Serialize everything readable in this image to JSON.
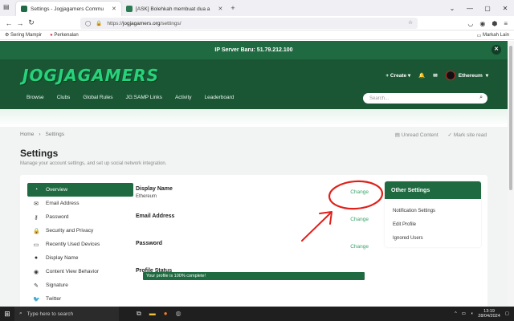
{
  "browser": {
    "tabs": [
      {
        "label": "Settings - Jogjagamers Commu",
        "active": true
      },
      {
        "label": "[ASK] Bolehkah membuat dua a",
        "active": false
      }
    ],
    "url_prefix": "https://",
    "url_host": "jogjagamers.org",
    "url_path": "/settings/",
    "bookmarks": [
      "Sering Mampir",
      "Perkenalan"
    ],
    "bookmarks_right": "Markah Lain"
  },
  "site": {
    "announcement": "IP Server Baru: 51.79.212.100",
    "logo": "JOGJAGAMERS",
    "create_label": "Create",
    "username": "Ethereum",
    "menu": [
      "Browse",
      "Clubs",
      "Global Rules",
      "JG:SAMP Links",
      "Activity",
      "Leaderboard"
    ],
    "search_placeholder": "Search..."
  },
  "page": {
    "breadcrumb": [
      "Home",
      "Settings"
    ],
    "unread": "Unread Content",
    "mark_read": "Mark site read",
    "title": "Settings",
    "subtitle": "Manage your account settings, and set up social network integration."
  },
  "sidebar": {
    "items": [
      {
        "label": "Overview",
        "icon": "tachometer-icon",
        "active": true
      },
      {
        "label": "Email Address",
        "icon": "envelope-icon"
      },
      {
        "label": "Password",
        "icon": "key-icon"
      },
      {
        "label": "Security and Privacy",
        "icon": "lock-icon"
      },
      {
        "label": "Recently Used Devices",
        "icon": "laptop-icon"
      },
      {
        "label": "Display Name",
        "icon": "user-icon"
      },
      {
        "label": "Content View Behavior",
        "icon": "eye-icon"
      },
      {
        "label": "Signature",
        "icon": "pencil-icon"
      },
      {
        "label": "Twitter",
        "icon": "twitter-icon"
      }
    ]
  },
  "overview": {
    "display_name_label": "Display Name",
    "display_name_value": "Ethereum",
    "email_label": "Email Address",
    "password_label": "Password",
    "change_label": "Change",
    "profile_status_label": "Profile Status",
    "profile_complete_text": "Your profile is 100% complete!",
    "profile_complete_fraction": 1.0
  },
  "other_settings": {
    "title": "Other Settings",
    "links": [
      "Notification Settings",
      "Edit Profile",
      "Ignored Users"
    ]
  },
  "taskbar": {
    "search_placeholder": "Type here to search",
    "time": "13:19",
    "date": "28/04/2024"
  },
  "colors": {
    "brand_green": "#1f6a41",
    "header_green": "#1a5634",
    "link_green": "#3aa36a",
    "annotation_red": "#e0201b"
  }
}
